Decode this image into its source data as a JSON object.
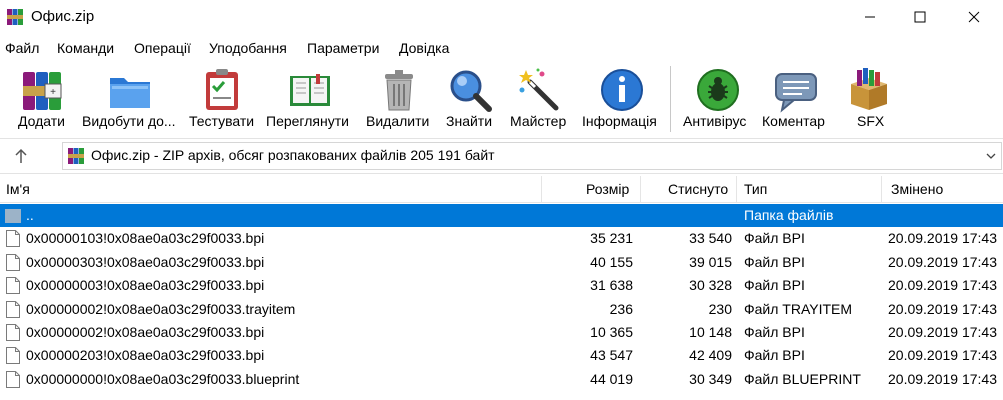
{
  "window": {
    "title": "Офис.zip"
  },
  "menu": [
    "Файл",
    "Команди",
    "Операції",
    "Уподобання",
    "Параметри",
    "Довідка"
  ],
  "toolbar": [
    {
      "label": "Додати",
      "icon": "add-archive-icon"
    },
    {
      "label": "Видобути до...",
      "icon": "extract-folder-icon"
    },
    {
      "label": "Тестувати",
      "icon": "test-clipboard-icon"
    },
    {
      "label": "Переглянути",
      "icon": "view-book-icon"
    },
    {
      "label": "Видалити",
      "icon": "trash-icon"
    },
    {
      "label": "Знайти",
      "icon": "find-magnifier-icon"
    },
    {
      "label": "Майстер",
      "icon": "wizard-wand-icon"
    },
    {
      "label": "Інформація",
      "icon": "info-icon"
    },
    {
      "label": "Антивірус",
      "icon": "antivirus-bug-icon"
    },
    {
      "label": "Коментар",
      "icon": "comment-bubble-icon"
    },
    {
      "label": "SFX",
      "icon": "sfx-box-icon"
    }
  ],
  "address": {
    "text": "Офис.zip - ZIP архів, обсяг розпакованих файлів 205 191 байт"
  },
  "columns": {
    "name": "Ім'я",
    "size": "Розмір",
    "packed": "Стиснуто",
    "type": "Тип",
    "modified": "Змінено"
  },
  "rows": [
    {
      "name": "..",
      "size": "",
      "packed": "",
      "type": "Папка файлів",
      "modified": "",
      "folder": true,
      "selected": true
    },
    {
      "name": "0x00000103!0x08ae0a03c29f0033.bpi",
      "size": "35 231",
      "packed": "33 540",
      "type": "Файл BPI",
      "modified": "20.09.2019 17:43"
    },
    {
      "name": "0x00000303!0x08ae0a03c29f0033.bpi",
      "size": "40 155",
      "packed": "39 015",
      "type": "Файл BPI",
      "modified": "20.09.2019 17:43"
    },
    {
      "name": "0x00000003!0x08ae0a03c29f0033.bpi",
      "size": "31 638",
      "packed": "30 328",
      "type": "Файл BPI",
      "modified": "20.09.2019 17:43"
    },
    {
      "name": "0x00000002!0x08ae0a03c29f0033.trayitem",
      "size": "236",
      "packed": "230",
      "type": "Файл TRAYITEM",
      "modified": "20.09.2019 17:43"
    },
    {
      "name": "0x00000002!0x08ae0a03c29f0033.bpi",
      "size": "10 365",
      "packed": "10 148",
      "type": "Файл BPI",
      "modified": "20.09.2019 17:43"
    },
    {
      "name": "0x00000203!0x08ae0a03c29f0033.bpi",
      "size": "43 547",
      "packed": "42 409",
      "type": "Файл BPI",
      "modified": "20.09.2019 17:43"
    },
    {
      "name": "0x00000000!0x08ae0a03c29f0033.blueprint",
      "size": "44 019",
      "packed": "30 349",
      "type": "Файл BLUEPRINT",
      "modified": "20.09.2019 17:43"
    }
  ],
  "colors": {
    "selection": "#0078d7",
    "accent": "#0078d7"
  }
}
